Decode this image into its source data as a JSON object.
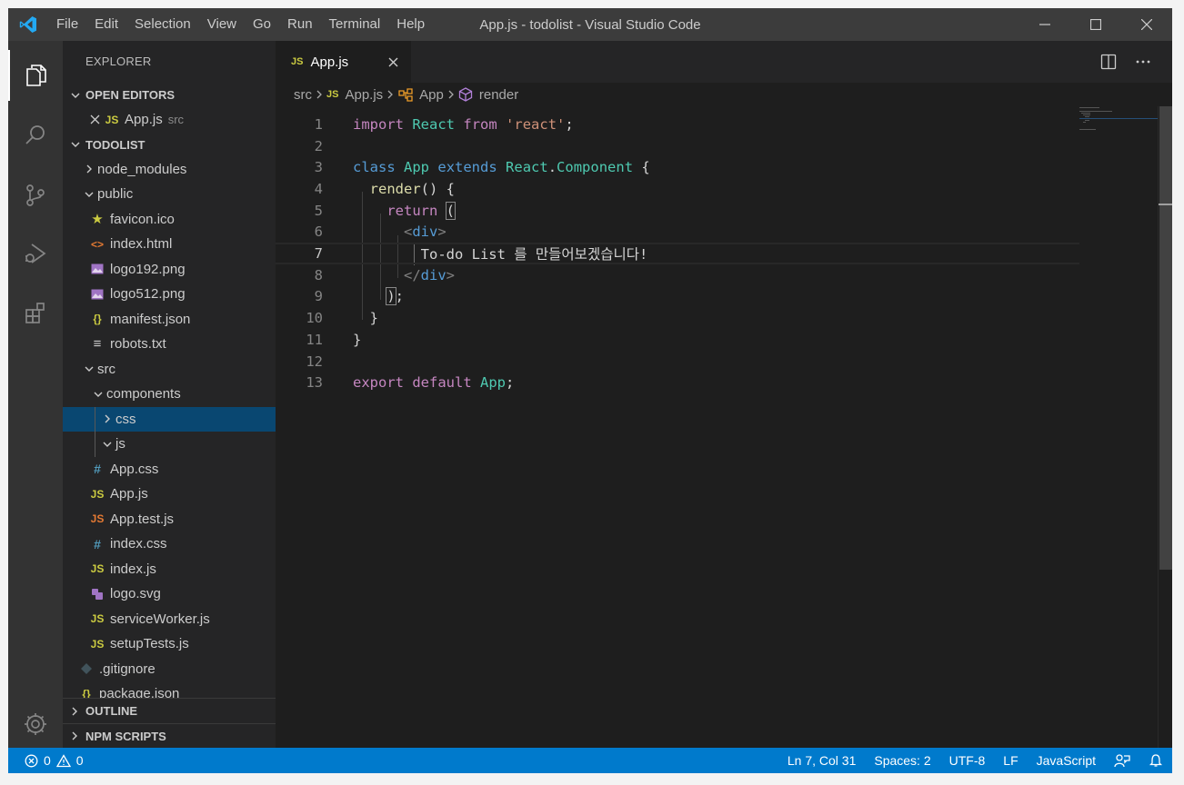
{
  "window": {
    "title": "App.js - todolist - Visual Studio Code"
  },
  "menu": [
    "File",
    "Edit",
    "Selection",
    "View",
    "Go",
    "Run",
    "Terminal",
    "Help"
  ],
  "activity_bar": {
    "items": [
      "explorer-icon",
      "search-icon",
      "source-control-icon",
      "run-debug-icon",
      "extensions-icon"
    ],
    "bottom": "settings-gear-icon"
  },
  "sidebar": {
    "title": "EXPLORER",
    "open_editors": {
      "label": "OPEN EDITORS",
      "files": [
        {
          "icon": "JS",
          "name": "App.js",
          "desc": "src"
        }
      ]
    },
    "project": {
      "label": "TODOLIST",
      "tree": [
        {
          "name": "node_modules",
          "type": "folder",
          "expanded": false,
          "depth": 1
        },
        {
          "name": "public",
          "type": "folder",
          "expanded": true,
          "depth": 1
        },
        {
          "name": "favicon.ico",
          "icon": "★",
          "depth": 2
        },
        {
          "name": "index.html",
          "icon": "<>",
          "depth": 2
        },
        {
          "name": "logo192.png",
          "icon": "img",
          "depth": 2
        },
        {
          "name": "logo512.png",
          "icon": "img",
          "depth": 2
        },
        {
          "name": "manifest.json",
          "icon": "{}",
          "depth": 2
        },
        {
          "name": "robots.txt",
          "icon": "≡",
          "depth": 2
        },
        {
          "name": "src",
          "type": "folder",
          "expanded": true,
          "depth": 1
        },
        {
          "name": "components",
          "type": "folder",
          "expanded": true,
          "depth": 2
        },
        {
          "name": "css",
          "type": "folder",
          "expanded": false,
          "depth": 3,
          "selected": true
        },
        {
          "name": "js",
          "type": "folder",
          "expanded": true,
          "depth": 3
        },
        {
          "name": "App.css",
          "icon": "#",
          "depth": 2
        },
        {
          "name": "App.js",
          "icon": "JS",
          "depth": 2
        },
        {
          "name": "App.test.js",
          "icon": "JS",
          "depth": 2
        },
        {
          "name": "index.css",
          "icon": "#",
          "depth": 2
        },
        {
          "name": "index.js",
          "icon": "JS",
          "depth": 2
        },
        {
          "name": "logo.svg",
          "icon": "svg",
          "depth": 2
        },
        {
          "name": "serviceWorker.js",
          "icon": "JS",
          "depth": 2
        },
        {
          "name": "setupTests.js",
          "icon": "JS",
          "depth": 2
        },
        {
          "name": ".gitignore",
          "icon": "git",
          "depth": 1
        },
        {
          "name": "package.json",
          "icon": "{}",
          "depth": 1
        }
      ]
    },
    "outline_label": "OUTLINE",
    "npm_scripts_label": "NPM SCRIPTS"
  },
  "editor": {
    "tab": {
      "icon": "JS",
      "label": "App.js"
    },
    "breadcrumb": {
      "folder": "src",
      "file_icon": "JS",
      "file": "App.js",
      "class": "App",
      "method": "render"
    },
    "line_numbers": [
      "1",
      "2",
      "3",
      "4",
      "5",
      "6",
      "7",
      "8",
      "9",
      "10",
      "11",
      "12",
      "13"
    ],
    "current_line": 7,
    "tokens": {
      "import": "import",
      "react_id": "React",
      "from": "from",
      "react_str": "'react'",
      "semi": ";",
      "class": "class",
      "app": "App",
      "extends": "extends",
      "react": "React",
      "dot": ".",
      "component": "Component",
      "lbrace": " {",
      "render": "render",
      "parens": "()",
      "return": "return",
      "lparen": "(",
      "lt": "<",
      "div": "div",
      "gt": ">",
      "close_lt": "</",
      "jsx_text": "To-do List 를 만들어보겠습니다!",
      "rparen": ")",
      "rbrace": "}",
      "export": "export",
      "default": "default"
    }
  },
  "statusbar": {
    "errors": "0",
    "warnings": "0",
    "position": "Ln 7, Col 31",
    "spaces": "Spaces: 2",
    "encoding": "UTF-8",
    "eol": "LF",
    "language": "JavaScript"
  },
  "colors": {
    "statusbar_bg": "#007acc",
    "selection_bg": "#094771",
    "js_icon": "#cbcb41",
    "keyword": "#c586c0",
    "storage": "#569cd6",
    "type": "#4ec9b0",
    "string": "#ce9178"
  }
}
